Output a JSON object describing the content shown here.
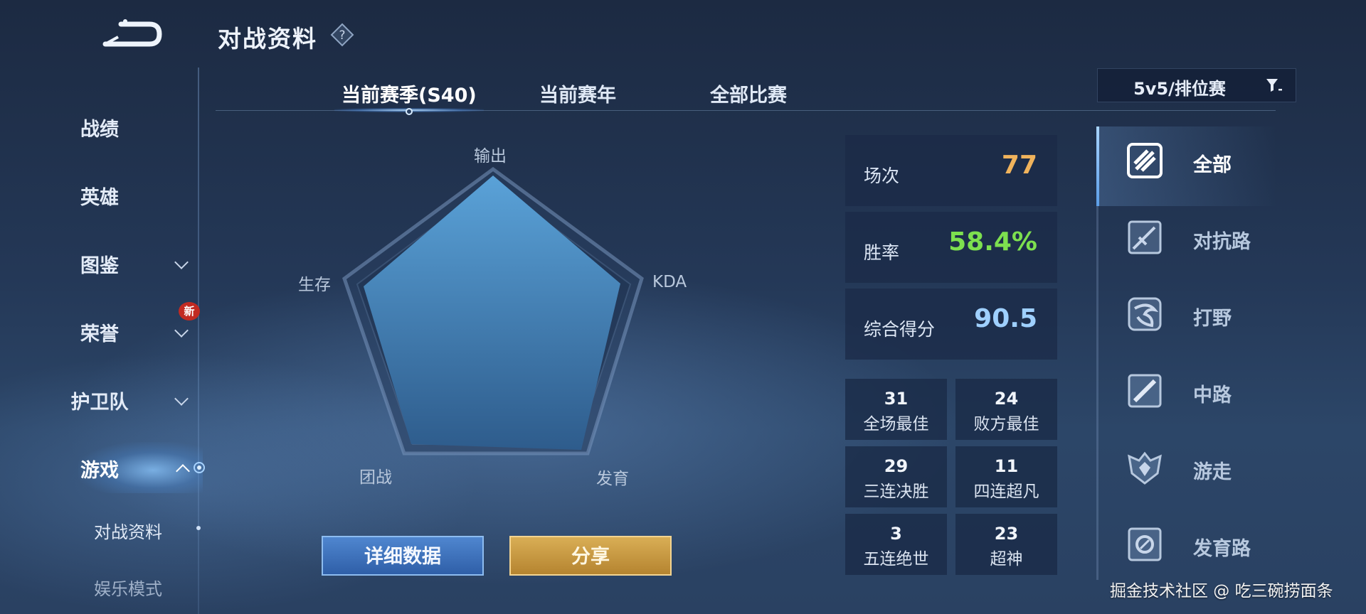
{
  "header": {
    "title": "对战资料",
    "back_icon": "back-arrow-icon",
    "help_icon": "question-icon"
  },
  "sidebar": {
    "items": [
      {
        "label": "战绩"
      },
      {
        "label": "英雄"
      },
      {
        "label": "图鉴"
      },
      {
        "label": "荣誉",
        "badge": "新"
      },
      {
        "label": "护卫队"
      },
      {
        "label": "游戏"
      }
    ],
    "subitems": [
      {
        "label": "对战资料"
      },
      {
        "label": "娱乐模式"
      }
    ]
  },
  "tabs": [
    {
      "label": "当前赛季(S40)"
    },
    {
      "label": "当前赛年"
    },
    {
      "label": "全部比赛"
    }
  ],
  "mode_filter": {
    "label": "5v5/排位赛"
  },
  "radar": {
    "labels": [
      "输出",
      "KDA",
      "发育",
      "团战",
      "生存"
    ]
  },
  "stats": {
    "matches": {
      "label": "场次",
      "value": "77",
      "color": "#f0b35c"
    },
    "win_rate": {
      "label": "胜率",
      "value": "58.4%",
      "color": "#7de04f"
    },
    "score": {
      "label": "综合得分",
      "value": "90.5",
      "color": "#9fd0ff"
    },
    "mini": [
      {
        "value": "31",
        "label": "全场最佳"
      },
      {
        "value": "24",
        "label": "败方最佳"
      },
      {
        "value": "29",
        "label": "三连决胜"
      },
      {
        "value": "11",
        "label": "四连超凡"
      },
      {
        "value": "3",
        "label": "五连绝世"
      },
      {
        "value": "23",
        "label": "超神"
      }
    ]
  },
  "roles": [
    {
      "label": "全部",
      "icon": "all-roles-icon"
    },
    {
      "label": "对抗路",
      "icon": "clash-lane-icon"
    },
    {
      "label": "打野",
      "icon": "jungle-icon"
    },
    {
      "label": "中路",
      "icon": "mid-lane-icon"
    },
    {
      "label": "游走",
      "icon": "roam-icon"
    },
    {
      "label": "发育路",
      "icon": "farm-lane-icon"
    }
  ],
  "buttons": {
    "details": "详细数据",
    "share": "分享"
  },
  "watermark": "掘金技术社区 @ 吃三碗捞面条"
}
